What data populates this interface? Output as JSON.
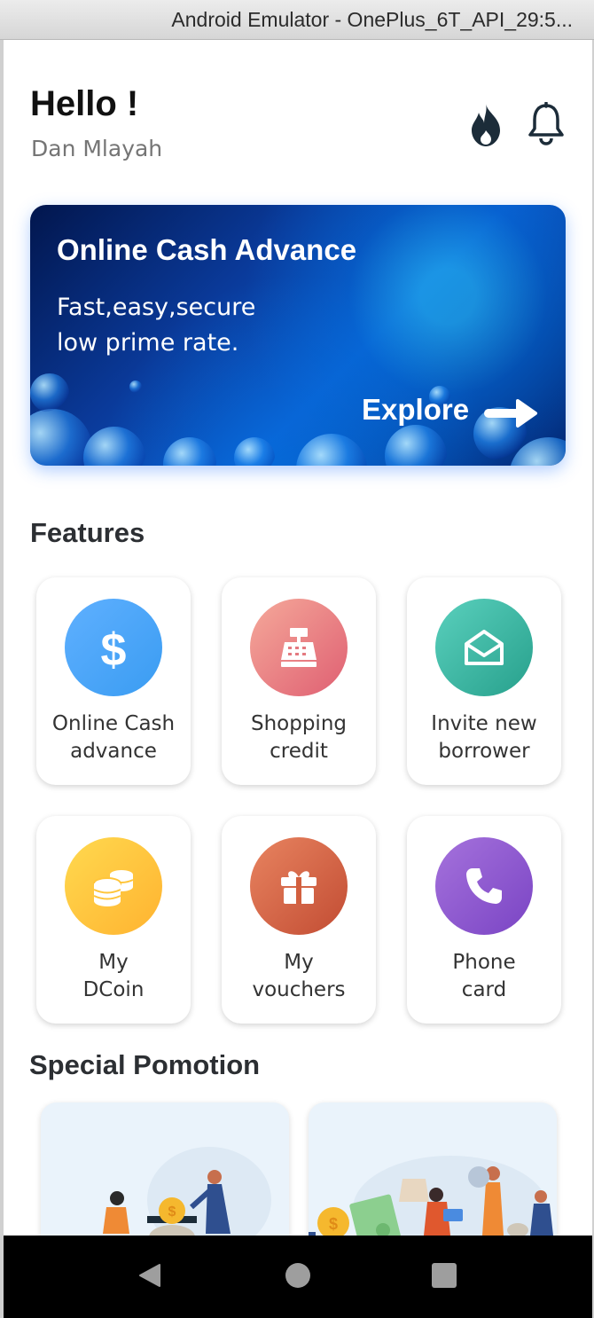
{
  "window": {
    "title": "Android Emulator - OnePlus_6T_API_29:5..."
  },
  "header": {
    "greeting": "Hello !",
    "user_name": "Dan Mlayah"
  },
  "banner": {
    "title": "Online Cash Advance",
    "subtitle_line1": "Fast,easy,secure",
    "subtitle_line2": "low prime rate.",
    "cta": "Explore"
  },
  "features": {
    "title": "Features",
    "items": [
      {
        "line1": "Online Cash",
        "line2": "advance",
        "icon": "dollar-icon",
        "colors": [
          "#4aa8ff",
          "#3fa1f5"
        ]
      },
      {
        "line1": "Shopping",
        "line2": "credit",
        "icon": "cash-register-icon",
        "colors": [
          "#f39a8c",
          "#e0626f"
        ]
      },
      {
        "line1": "Invite new",
        "line2": "borrower",
        "icon": "envelope-open-icon",
        "colors": [
          "#4ec9b6",
          "#2aa38f"
        ]
      },
      {
        "line1": "My",
        "line2": "DCoin",
        "icon": "coins-icon",
        "colors": [
          "#ffd54a",
          "#ffb62e"
        ]
      },
      {
        "line1": "My",
        "line2": "vouchers",
        "icon": "gift-icon",
        "colors": [
          "#e57a56",
          "#c65034"
        ]
      },
      {
        "line1": "Phone",
        "line2": "card",
        "icon": "phone-icon",
        "colors": [
          "#a06ad8",
          "#7d47c6"
        ]
      }
    ]
  },
  "promotion": {
    "title": "Special Pomotion"
  },
  "colors": {
    "accent": "#1c2c39",
    "screen_bg": "#ffffff",
    "navbar": "#000000"
  }
}
